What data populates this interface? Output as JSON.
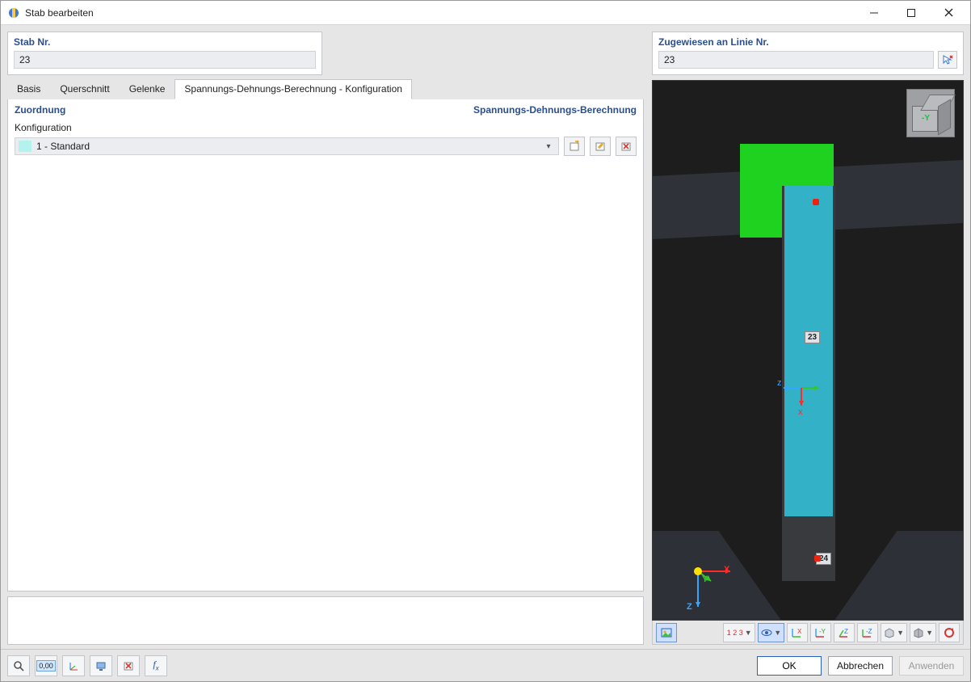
{
  "title": "Stab bearbeiten",
  "member_no": {
    "label": "Stab Nr.",
    "value": "23"
  },
  "assigned": {
    "label": "Zugewiesen an Linie Nr.",
    "value": "23"
  },
  "tabs": [
    "Basis",
    "Querschnitt",
    "Gelenke",
    "Spannungs-Dehnungs-Berechnung - Konfiguration"
  ],
  "active_tab": 3,
  "section": {
    "left_header": "Zuordnung",
    "right_header": "Spannungs-Dehnungs-Berechnung",
    "field_label": "Konfiguration",
    "combo_value": "1 - Standard"
  },
  "viewer": {
    "member_tag": "23",
    "node_tag": "24",
    "axes": {
      "x": "X",
      "y": "Y",
      "z": "Z",
      "local_z": "z",
      "local_x": "x"
    }
  },
  "viewer_tools": {
    "num_label": "1 2 3"
  },
  "buttons": {
    "ok": "OK",
    "cancel": "Abbrechen",
    "apply": "Anwenden"
  }
}
